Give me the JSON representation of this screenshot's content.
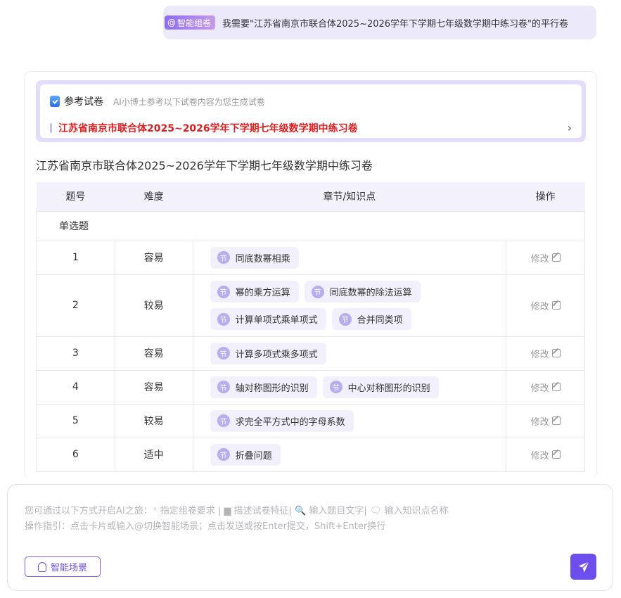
{
  "message": {
    "mode_tag": "智能组卷",
    "text": "我需要\"江苏省南京市联合体2025~2026学年下学期七年级数学期中练习卷\"的平行卷"
  },
  "reference": {
    "title": "参考试卷",
    "subtitle": "AI小博士参考以下试卷内容为您生成试卷",
    "link": "江苏省南京市联合体2025~2026学年下学期七年级数学期中练习卷"
  },
  "paper_title": "江苏省南京市联合体2025~2026学年下学期七年级数学期中练习卷",
  "table": {
    "headers": [
      "题号",
      "难度",
      "章节/知识点",
      "操作"
    ],
    "section": "单选题",
    "chip_glyph": "节",
    "edit_label": "修改",
    "rows": [
      {
        "no": "1",
        "difficulty": "容易",
        "topics": [
          "同底数幂相乘"
        ]
      },
      {
        "no": "2",
        "difficulty": "较易",
        "topics": [
          "幂的乘方运算",
          "同底数幂的除法运算",
          "计算单项式乘单项式",
          "合并同类项"
        ]
      },
      {
        "no": "3",
        "difficulty": "容易",
        "topics": [
          "计算多项式乘多项式"
        ]
      },
      {
        "no": "4",
        "difficulty": "容易",
        "topics": [
          "轴对称图形的识别",
          "中心对称图形的识别"
        ]
      },
      {
        "no": "5",
        "difficulty": "较易",
        "topics": [
          "求完全平方式中的字母系数"
        ]
      },
      {
        "no": "6",
        "difficulty": "适中",
        "topics": [
          "折叠问题"
        ]
      }
    ]
  },
  "composer": {
    "hint_line1": "您可通过以下方式开启AI之旅：⁺ 指定组卷要求 | ▆ 描述试卷特征| 🔍 输入题目文字| 🗨 输入知识点名称",
    "hint_line2": "操作指引：点击卡片或输入@切换智能场景；点击发送或按Enter提交，Shift+Enter换行",
    "scene_button": "智能场景"
  },
  "colors": {
    "accent": "#6b4eec",
    "link_red": "#e01e1e",
    "bubble_bg": "#ece9fb",
    "header_bg": "#f2f1fc"
  }
}
